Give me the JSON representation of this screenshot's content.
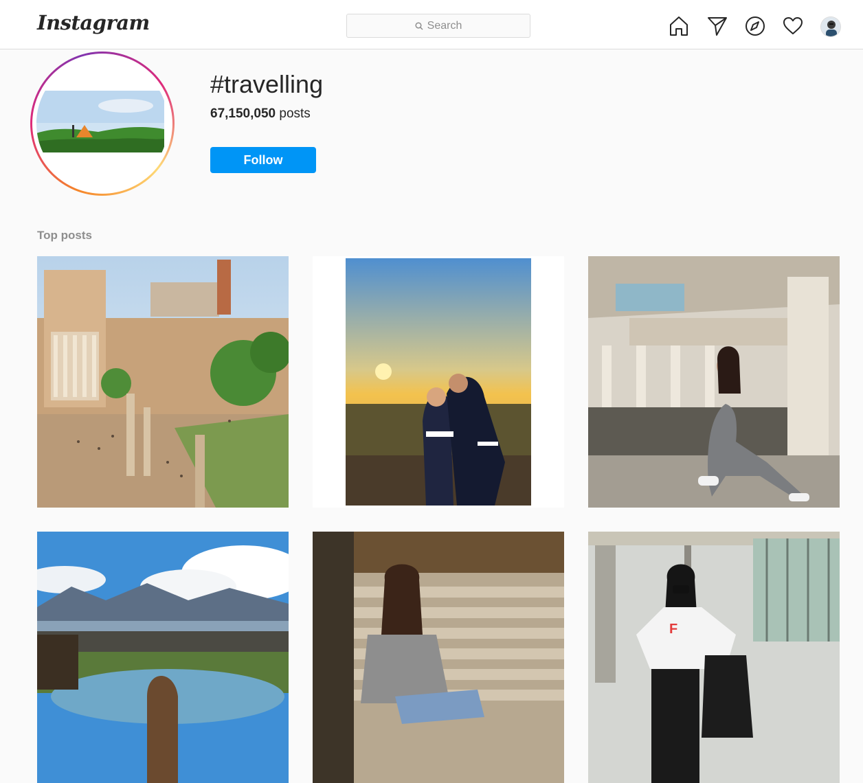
{
  "nav": {
    "logo": "Instagram",
    "search_placeholder": "Search",
    "icons": [
      "home-icon",
      "direct-icon",
      "explore-icon",
      "activity-heart-icon",
      "profile-avatar"
    ]
  },
  "hashtag": {
    "name": "#travelling",
    "posts_count": "67,150,050",
    "posts_label": "posts",
    "follow_label": "Follow"
  },
  "top_posts": {
    "label": "Top posts",
    "items": [
      {
        "subject": "roman-forum-ruins"
      },
      {
        "subject": "couple-kissing-at-sunset"
      },
      {
        "subject": "woman-posing-in-abandoned-building"
      },
      {
        "subject": "mountain-view-hot-tub"
      },
      {
        "subject": "girl-sitting-on-stone-steps"
      },
      {
        "subject": "woman-with-mask-at-airport"
      }
    ]
  },
  "colors": {
    "accent": "#0095f6",
    "background": "#fafafa",
    "border": "#dbdbdb",
    "text": "#262626",
    "muted": "#8e8e8e"
  }
}
